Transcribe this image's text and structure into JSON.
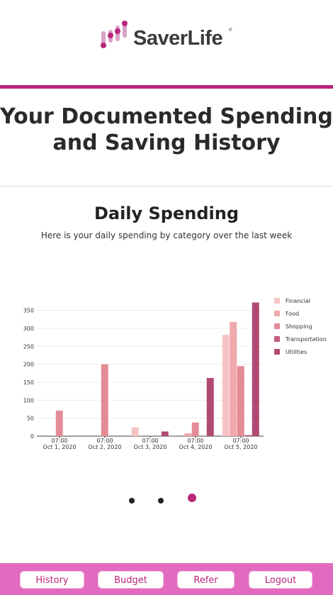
{
  "brand": {
    "name": "SaverLife",
    "reg_mark": "®",
    "accent": "#b8267a"
  },
  "page_title": "Your Documented Spending and Saving History",
  "section": {
    "title": "Daily Spending",
    "subtitle": "Here is your daily spending by category over the last week"
  },
  "chart_data": {
    "type": "bar",
    "title": "",
    "xlabel": "",
    "ylabel": "",
    "categories": [
      [
        "07:00",
        "Oct 1, 2020"
      ],
      [
        "07:00",
        "Oct 2, 2020"
      ],
      [
        "07:00",
        "Oct 3, 2020"
      ],
      [
        "07:00",
        "Oct 4, 2020"
      ],
      [
        "07:00",
        "Oct 5, 2020"
      ]
    ],
    "yticks": [
      0,
      50,
      100,
      150,
      200,
      250,
      300,
      350
    ],
    "ylim": [
      0,
      385
    ],
    "grid": true,
    "legend_position": "right",
    "series": [
      {
        "name": "Financial",
        "color": "#f7c4c6",
        "values": [
          0,
          0,
          25,
          0,
          282
        ]
      },
      {
        "name": "Food",
        "color": "#f0a9ac",
        "values": [
          0,
          0,
          0,
          8,
          318
        ]
      },
      {
        "name": "Shopping",
        "color": "#e48b98",
        "values": [
          71,
          200,
          0,
          38,
          195
        ]
      },
      {
        "name": "Transportation",
        "color": "#c45d80",
        "values": [
          0,
          0,
          0,
          0,
          3
        ]
      },
      {
        "name": "Utilities",
        "color": "#b04a72",
        "values": [
          0,
          0,
          13,
          162,
          372
        ]
      }
    ]
  },
  "carousel": {
    "count": 3,
    "active_index": 2
  },
  "footer": {
    "history": "History",
    "budget": "Budget",
    "refer": "Refer",
    "logout": "Logout"
  }
}
